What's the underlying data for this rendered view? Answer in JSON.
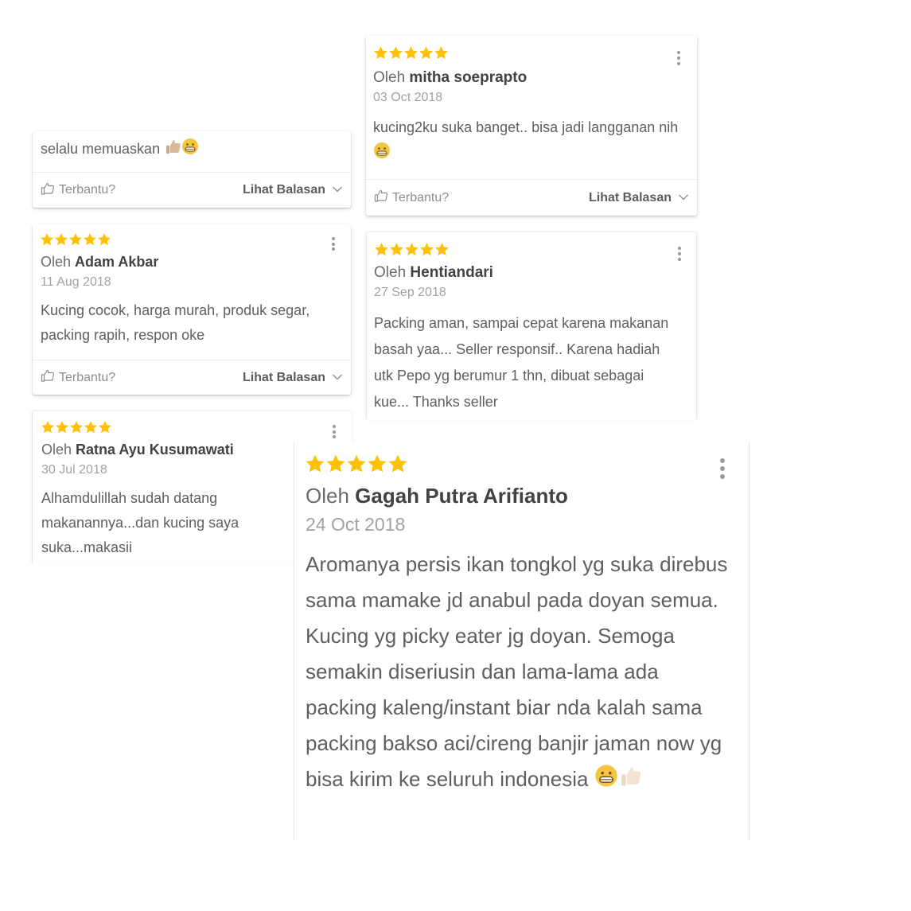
{
  "colors": {
    "star": "#FFC107",
    "text": "#5f5f5f",
    "muted": "#a2a2a2",
    "name": "#424242"
  },
  "review_prefix": "Oleh",
  "reviews": [
    {
      "body": "selalu memuaskan",
      "emoji": [
        "thumbs-up-icon",
        "grinning-face-icon"
      ],
      "helpful_label": "Terbantu?",
      "replies_label": "Lihat Balasan"
    },
    {
      "rating": 5,
      "author": "mitha soeprapto",
      "date": "03 Oct 2018",
      "body": "kucing2ku suka banget.. bisa jadi langganan nih",
      "emoji": [
        "grinning-face-icon"
      ],
      "helpful_label": "Terbantu?",
      "replies_label": "Lihat Balasan"
    },
    {
      "rating": 5,
      "author": "Adam Akbar",
      "date": "11 Aug 2018",
      "body": "Kucing cocok, harga murah, produk segar, packing rapih, respon oke",
      "helpful_label": "Terbantu?",
      "replies_label": "Lihat Balasan"
    },
    {
      "rating": 5,
      "author": "Hentiandari",
      "date": "27 Sep 2018",
      "body": "Packing aman, sampai cepat karena makanan basah yaa... Seller responsif.. Karena hadiah utk Pepo yg berumur 1 thn, dibuat sebagai kue... Thanks seller"
    },
    {
      "rating": 5,
      "author": "Ratna Ayu Kusumawati",
      "date": "30 Jul 2018",
      "body": "Alhamdulillah sudah datang makanannya...dan kucing saya suka...makasii"
    },
    {
      "rating": 5,
      "author": "Gagah Putra Arifianto",
      "date": "24 Oct 2018",
      "body": "Aromanya persis ikan tongkol yg suka direbus sama mamake jd anabul pada doyan semua. Kucing yg picky eater jg doyan. Semoga semakin diseriusin dan lama-lama ada packing kaleng/instant biar nda kalah sama packing bakso aci/cireng banjir jaman now yg bisa kirim ke seluruh indonesia",
      "emoji": [
        "grinning-face-icon",
        "thumbs-up-icon"
      ]
    }
  ]
}
